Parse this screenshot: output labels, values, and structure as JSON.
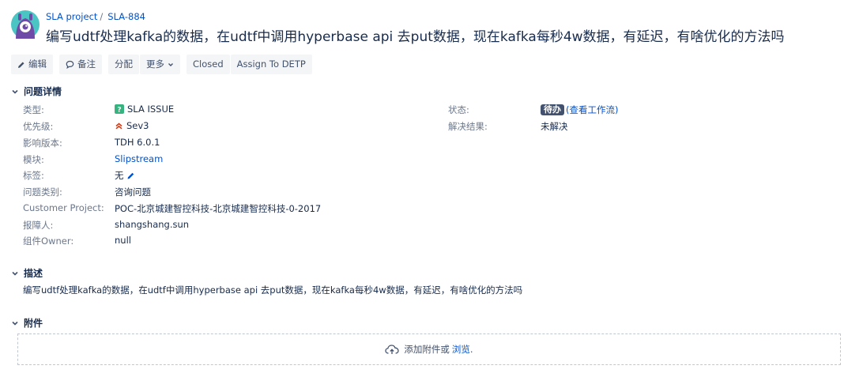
{
  "breadcrumb": {
    "project": "SLA project",
    "separator": "/",
    "issue_key": "SLA-884"
  },
  "issue": {
    "title": "编写udtf处理kafka的数据，在udtf中调用hyperbase api 去put数据，现在kafka每秒4w数据，有延迟，有啥优化的方法吗"
  },
  "toolbar": {
    "edit": "编辑",
    "comment": "备注",
    "assign": "分配",
    "more": "更多",
    "closed": "Closed",
    "assign_to": "Assign To DETP"
  },
  "details": {
    "heading": "问题详情",
    "type_label": "类型:",
    "type_value": "SLA ISSUE",
    "priority_label": "优先级:",
    "priority_value": "Sev3",
    "affects_label": "影响版本:",
    "affects_value": "TDH 6.0.1",
    "component_label": "模块:",
    "component_value": "Slipstream",
    "labels_label": "标签:",
    "labels_value": "无",
    "category_label": "问题类别:",
    "category_value": "咨询问题",
    "customer_label": "Customer Project:",
    "customer_value": "POC-北京城建智控科技-北京城建智控科技-0-2017",
    "reporter_label": "报障人:",
    "reporter_value": "shangshang.sun",
    "owner_label": "组件Owner:",
    "owner_value": "null",
    "status_label": "状态:",
    "status_value": "待办",
    "status_link": "(查看工作流)",
    "resolution_label": "解决结果:",
    "resolution_value": "未解决"
  },
  "description": {
    "heading": "描述",
    "text": "编写udtf处理kafka的数据，在udtf中调用hyperbase api 去put数据，现在kafka每秒4w数据，有延迟，有啥优化的方法吗"
  },
  "attachments": {
    "heading": "附件",
    "drop_text": "添加附件或",
    "browse_link": "浏览",
    "period": "."
  },
  "colors": {
    "link": "#0052cc",
    "status_bg": "#42526e",
    "type_icon": "#36b37e",
    "priority_icon": "#de350b"
  }
}
